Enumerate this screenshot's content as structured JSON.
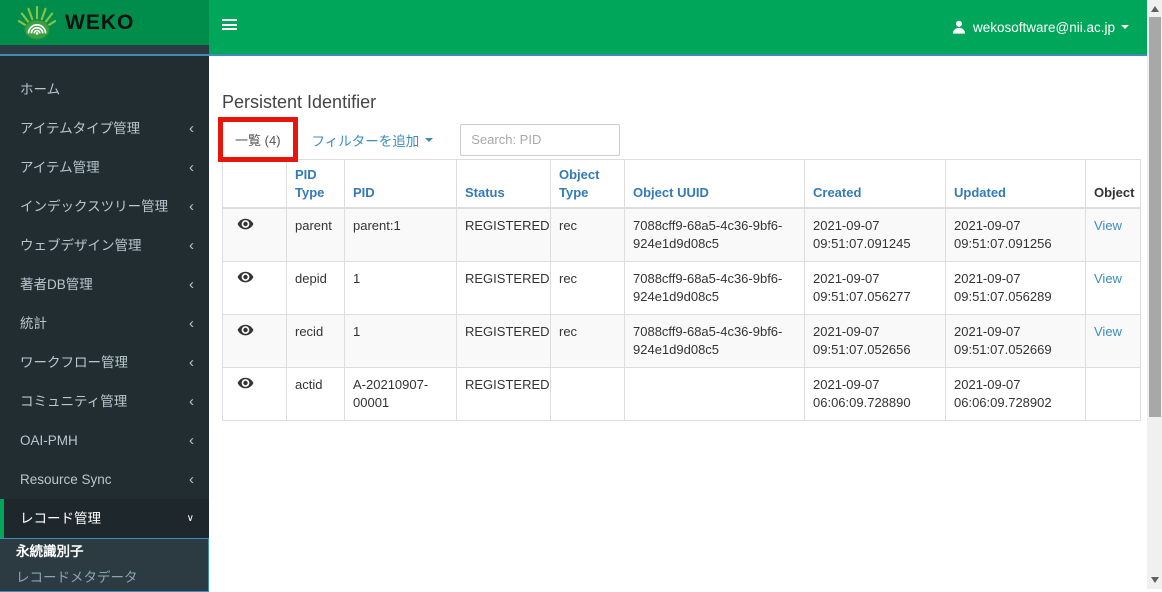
{
  "header": {
    "brand": "WEKO",
    "user_email": "wekosoftware@nii.ac.jp"
  },
  "sidebar": {
    "items": [
      {
        "label": "ホーム",
        "expandable": false,
        "expanded": false,
        "active": false
      },
      {
        "label": "アイテムタイプ管理",
        "expandable": true,
        "expanded": false,
        "active": false
      },
      {
        "label": "アイテム管理",
        "expandable": true,
        "expanded": false,
        "active": false
      },
      {
        "label": "インデックスツリー管理",
        "expandable": true,
        "expanded": false,
        "active": false
      },
      {
        "label": "ウェブデザイン管理",
        "expandable": true,
        "expanded": false,
        "active": false
      },
      {
        "label": "著者DB管理",
        "expandable": true,
        "expanded": false,
        "active": false
      },
      {
        "label": "統計",
        "expandable": true,
        "expanded": false,
        "active": false
      },
      {
        "label": "ワークフロー管理",
        "expandable": true,
        "expanded": false,
        "active": false
      },
      {
        "label": "コミュニティ管理",
        "expandable": true,
        "expanded": false,
        "active": false
      },
      {
        "label": "OAI-PMH",
        "expandable": true,
        "expanded": false,
        "active": false
      },
      {
        "label": "Resource Sync",
        "expandable": true,
        "expanded": false,
        "active": false
      },
      {
        "label": "レコード管理",
        "expandable": true,
        "expanded": true,
        "active": true
      }
    ],
    "submenu": [
      {
        "label": "永続識別子",
        "active": true
      },
      {
        "label": "レコードメタデータ",
        "active": false
      }
    ]
  },
  "main": {
    "title": "Persistent Identifier",
    "tab_label": "一覧",
    "tab_count": "(4)",
    "filter_label": "フィルターを追加",
    "search_placeholder": "Search: PID",
    "table": {
      "headers": [
        {
          "label": "",
          "sortable": false
        },
        {
          "label": "PID Type",
          "sortable": true
        },
        {
          "label": "PID",
          "sortable": true
        },
        {
          "label": "Status",
          "sortable": true
        },
        {
          "label": "Object Type",
          "sortable": true
        },
        {
          "label": "Object UUID",
          "sortable": true
        },
        {
          "label": "Created",
          "sortable": true
        },
        {
          "label": "Updated",
          "sortable": true
        },
        {
          "label": "Object",
          "sortable": false
        }
      ],
      "rows": [
        {
          "pid_type": "parent",
          "pid": "parent:1",
          "status": "REGISTERED",
          "object_type": "rec",
          "object_uuid": "7088cff9-68a5-4c36-9bf6-924e1d9d08c5",
          "created": "2021-09-07 09:51:07.091245",
          "updated": "2021-09-07 09:51:07.091256",
          "object_link": "View"
        },
        {
          "pid_type": "depid",
          "pid": "1",
          "status": "REGISTERED",
          "object_type": "rec",
          "object_uuid": "7088cff9-68a5-4c36-9bf6-924e1d9d08c5",
          "created": "2021-09-07 09:51:07.056277",
          "updated": "2021-09-07 09:51:07.056289",
          "object_link": "View"
        },
        {
          "pid_type": "recid",
          "pid": "1",
          "status": "REGISTERED",
          "object_type": "rec",
          "object_uuid": "7088cff9-68a5-4c36-9bf6-924e1d9d08c5",
          "created": "2021-09-07 09:51:07.052656",
          "updated": "2021-09-07 09:51:07.052669",
          "object_link": "View"
        },
        {
          "pid_type": "actid",
          "pid": "A-20210907-00001",
          "status": "REGISTERED",
          "object_type": "",
          "object_uuid": "",
          "created": "2021-09-07 06:06:09.728890",
          "updated": "2021-09-07 06:06:09.728902",
          "object_link": ""
        }
      ]
    }
  },
  "colors": {
    "navbar_green": "#00a65a",
    "logo_green": "#008d4c",
    "accent_blue_line": "#3c8dbc",
    "sidebar_dark": "#222d32",
    "header_link_blue": "#337ab7",
    "link_blue": "#3c8dbc",
    "annotation_red": "#e8150b"
  }
}
